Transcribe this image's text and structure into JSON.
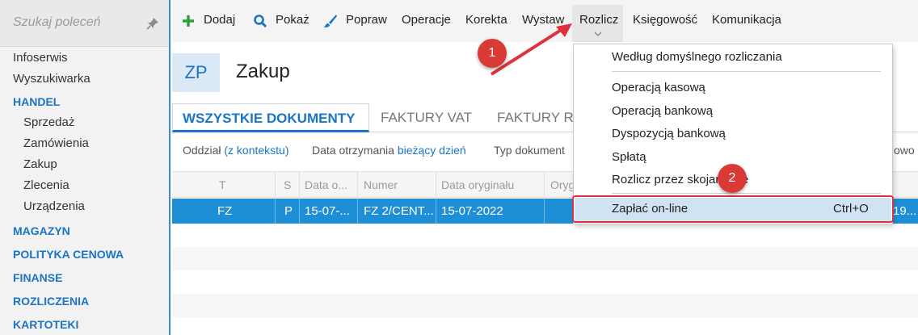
{
  "sidebar": {
    "search_placeholder": "Szukaj poleceń",
    "items": [
      {
        "label": "Infoserwis",
        "kind": "item"
      },
      {
        "label": "Wyszukiwarka",
        "kind": "item"
      },
      {
        "label": "HANDEL",
        "kind": "head"
      },
      {
        "label": "Sprzedaż",
        "kind": "sub"
      },
      {
        "label": "Zamówienia",
        "kind": "sub"
      },
      {
        "label": "Zakup",
        "kind": "sub"
      },
      {
        "label": "Zlecenia",
        "kind": "sub"
      },
      {
        "label": "Urządzenia",
        "kind": "sub"
      },
      {
        "label": "MAGAZYN",
        "kind": "head"
      },
      {
        "label": "POLITYKA CENOWA",
        "kind": "head"
      },
      {
        "label": "FINANSE",
        "kind": "head"
      },
      {
        "label": "ROZLICZENIA",
        "kind": "head"
      },
      {
        "label": "KARTOTEKI",
        "kind": "head"
      }
    ]
  },
  "toolbar": {
    "add": "Dodaj",
    "show": "Pokaż",
    "edit": "Popraw",
    "operations": "Operacje",
    "correction": "Korekta",
    "issue": "Wystaw",
    "settle": "Rozlicz",
    "accounting": "Księgowość",
    "communication": "Komunikacja"
  },
  "header": {
    "badge": "ZP",
    "title": "Zakup"
  },
  "tabs": [
    "WSZYSTKIE DOKUMENTY",
    "FAKTURY VAT",
    "FAKTURY RR"
  ],
  "filters": {
    "branch_label": "Oddział",
    "branch_value": "(z kontekstu)",
    "date_label": "Data otrzymania",
    "date_value": "bieżący dzień",
    "type_label": "Typ dokument",
    "extra": "owo"
  },
  "grid": {
    "columns": [
      "T",
      "S",
      "Data o...",
      "Numer",
      "Data oryginału",
      "Oryg"
    ],
    "rows": [
      {
        "t": "FZ",
        "s": "P",
        "date": "15-07-...",
        "number": "FZ 2/CENT...",
        "orig_date": "15-07-2022",
        "tail": "19..."
      }
    ]
  },
  "menu": {
    "items": [
      "Według domyślnego rozliczania",
      "Operacją kasową",
      "Operacją bankową",
      "Dyspozycją bankową",
      "Spłatą",
      "Rozlicz przez skojarzenie",
      "Zapłać on-line"
    ],
    "shortcut": "Ctrl+O"
  },
  "callouts": [
    "1",
    "2"
  ],
  "colors": {
    "accent": "#1b74c6",
    "selected_row": "#1e8ed6",
    "annotation": "#e0313c"
  }
}
